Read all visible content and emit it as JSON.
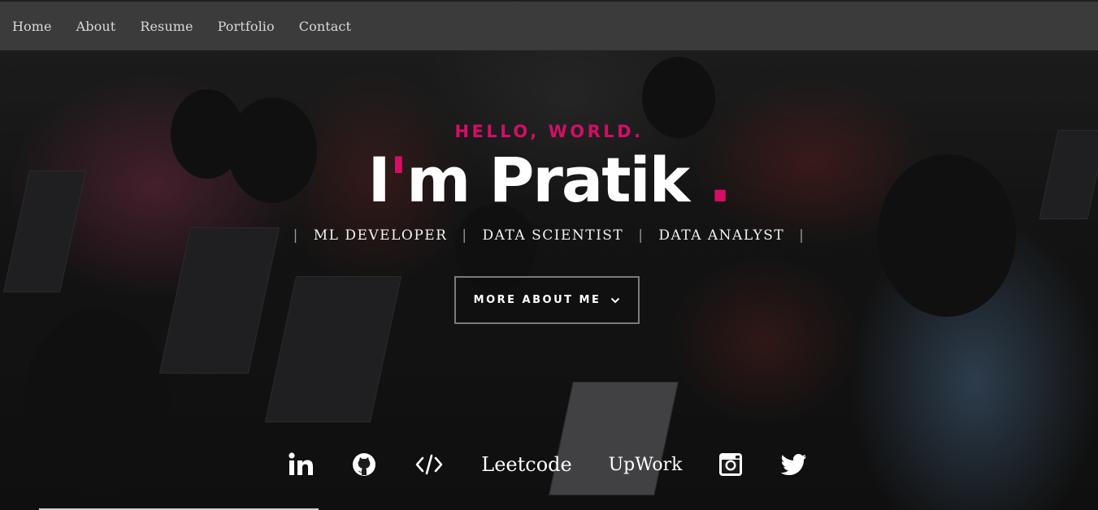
{
  "nav": {
    "items": [
      {
        "label": "Home"
      },
      {
        "label": "About"
      },
      {
        "label": "Resume"
      },
      {
        "label": "Portfolio"
      },
      {
        "label": "Contact"
      }
    ]
  },
  "hero": {
    "greeting": "HELLO, WORLD.",
    "title_prefix": "I",
    "title_apostrophe": "'",
    "title_rest": "m Pratik",
    "title_dot": " .",
    "roles": [
      "ML DEVELOPER",
      "DATA SCIENTIST",
      "DATA ANALYST"
    ],
    "separator": "|",
    "button_label": "MORE ABOUT ME"
  },
  "social": {
    "leetcode_label": "Leetcode",
    "upwork_label": "UpWork",
    "icons": [
      "linkedin-icon",
      "github-icon",
      "code-icon",
      "instagram-icon",
      "twitter-icon"
    ]
  },
  "colors": {
    "accent": "#d40e66",
    "nav_bg": "#3e3e3e",
    "text": "#ffffff"
  }
}
